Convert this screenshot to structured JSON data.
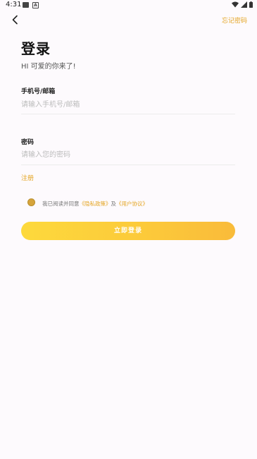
{
  "status_bar": {
    "time": "4:31",
    "a_icon_letter": "A"
  },
  "header": {
    "forgot_password": "忘记密码"
  },
  "title": "登录",
  "subtitle": "HI 可爱的你来了!",
  "phone_email": {
    "label": "手机号/邮箱",
    "placeholder": "请输入手机号/邮箱",
    "value": ""
  },
  "password": {
    "label": "密码",
    "placeholder": "请输入您的密码",
    "value": ""
  },
  "register_link": "注册",
  "agreement": {
    "prefix": "我已阅读并同意",
    "privacy_link": "《隐私政策》",
    "and": "及",
    "user_link": "《用户协议》",
    "checked": true
  },
  "login_button": "立即登录",
  "colors": {
    "accent": "#e4a422",
    "button_start": "#fdd93c",
    "button_end": "#f9bb3a",
    "background": "#fdfafd"
  },
  "icons": [
    "back-arrow-icon",
    "wifi-icon",
    "signal-icon",
    "battery-icon"
  ]
}
